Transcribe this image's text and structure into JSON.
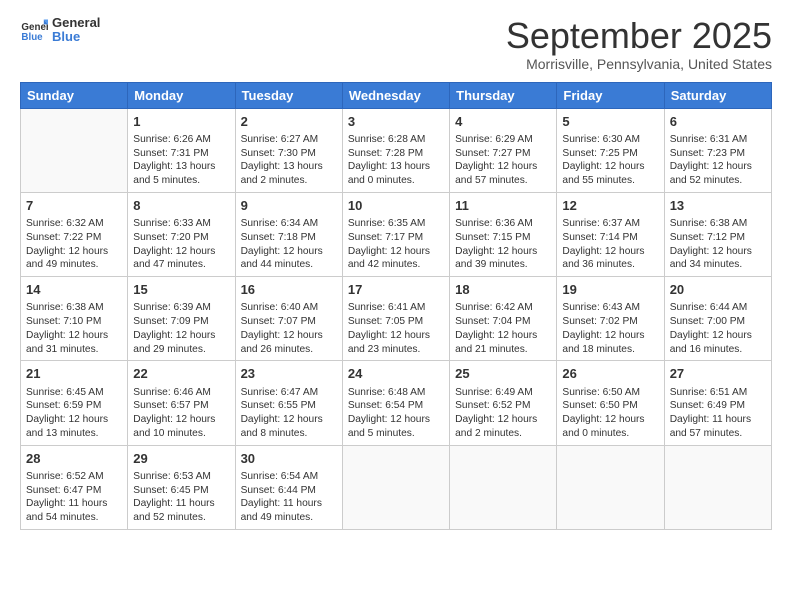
{
  "header": {
    "logo_general": "General",
    "logo_blue": "Blue",
    "month_year": "September 2025",
    "location": "Morrisville, Pennsylvania, United States"
  },
  "days_of_week": [
    "Sunday",
    "Monday",
    "Tuesday",
    "Wednesday",
    "Thursday",
    "Friday",
    "Saturday"
  ],
  "weeks": [
    [
      {
        "day": "",
        "content": ""
      },
      {
        "day": "1",
        "content": "Sunrise: 6:26 AM\nSunset: 7:31 PM\nDaylight: 13 hours\nand 5 minutes."
      },
      {
        "day": "2",
        "content": "Sunrise: 6:27 AM\nSunset: 7:30 PM\nDaylight: 13 hours\nand 2 minutes."
      },
      {
        "day": "3",
        "content": "Sunrise: 6:28 AM\nSunset: 7:28 PM\nDaylight: 13 hours\nand 0 minutes."
      },
      {
        "day": "4",
        "content": "Sunrise: 6:29 AM\nSunset: 7:27 PM\nDaylight: 12 hours\nand 57 minutes."
      },
      {
        "day": "5",
        "content": "Sunrise: 6:30 AM\nSunset: 7:25 PM\nDaylight: 12 hours\nand 55 minutes."
      },
      {
        "day": "6",
        "content": "Sunrise: 6:31 AM\nSunset: 7:23 PM\nDaylight: 12 hours\nand 52 minutes."
      }
    ],
    [
      {
        "day": "7",
        "content": "Sunrise: 6:32 AM\nSunset: 7:22 PM\nDaylight: 12 hours\nand 49 minutes."
      },
      {
        "day": "8",
        "content": "Sunrise: 6:33 AM\nSunset: 7:20 PM\nDaylight: 12 hours\nand 47 minutes."
      },
      {
        "day": "9",
        "content": "Sunrise: 6:34 AM\nSunset: 7:18 PM\nDaylight: 12 hours\nand 44 minutes."
      },
      {
        "day": "10",
        "content": "Sunrise: 6:35 AM\nSunset: 7:17 PM\nDaylight: 12 hours\nand 42 minutes."
      },
      {
        "day": "11",
        "content": "Sunrise: 6:36 AM\nSunset: 7:15 PM\nDaylight: 12 hours\nand 39 minutes."
      },
      {
        "day": "12",
        "content": "Sunrise: 6:37 AM\nSunset: 7:14 PM\nDaylight: 12 hours\nand 36 minutes."
      },
      {
        "day": "13",
        "content": "Sunrise: 6:38 AM\nSunset: 7:12 PM\nDaylight: 12 hours\nand 34 minutes."
      }
    ],
    [
      {
        "day": "14",
        "content": "Sunrise: 6:38 AM\nSunset: 7:10 PM\nDaylight: 12 hours\nand 31 minutes."
      },
      {
        "day": "15",
        "content": "Sunrise: 6:39 AM\nSunset: 7:09 PM\nDaylight: 12 hours\nand 29 minutes."
      },
      {
        "day": "16",
        "content": "Sunrise: 6:40 AM\nSunset: 7:07 PM\nDaylight: 12 hours\nand 26 minutes."
      },
      {
        "day": "17",
        "content": "Sunrise: 6:41 AM\nSunset: 7:05 PM\nDaylight: 12 hours\nand 23 minutes."
      },
      {
        "day": "18",
        "content": "Sunrise: 6:42 AM\nSunset: 7:04 PM\nDaylight: 12 hours\nand 21 minutes."
      },
      {
        "day": "19",
        "content": "Sunrise: 6:43 AM\nSunset: 7:02 PM\nDaylight: 12 hours\nand 18 minutes."
      },
      {
        "day": "20",
        "content": "Sunrise: 6:44 AM\nSunset: 7:00 PM\nDaylight: 12 hours\nand 16 minutes."
      }
    ],
    [
      {
        "day": "21",
        "content": "Sunrise: 6:45 AM\nSunset: 6:59 PM\nDaylight: 12 hours\nand 13 minutes."
      },
      {
        "day": "22",
        "content": "Sunrise: 6:46 AM\nSunset: 6:57 PM\nDaylight: 12 hours\nand 10 minutes."
      },
      {
        "day": "23",
        "content": "Sunrise: 6:47 AM\nSunset: 6:55 PM\nDaylight: 12 hours\nand 8 minutes."
      },
      {
        "day": "24",
        "content": "Sunrise: 6:48 AM\nSunset: 6:54 PM\nDaylight: 12 hours\nand 5 minutes."
      },
      {
        "day": "25",
        "content": "Sunrise: 6:49 AM\nSunset: 6:52 PM\nDaylight: 12 hours\nand 2 minutes."
      },
      {
        "day": "26",
        "content": "Sunrise: 6:50 AM\nSunset: 6:50 PM\nDaylight: 12 hours\nand 0 minutes."
      },
      {
        "day": "27",
        "content": "Sunrise: 6:51 AM\nSunset: 6:49 PM\nDaylight: 11 hours\nand 57 minutes."
      }
    ],
    [
      {
        "day": "28",
        "content": "Sunrise: 6:52 AM\nSunset: 6:47 PM\nDaylight: 11 hours\nand 54 minutes."
      },
      {
        "day": "29",
        "content": "Sunrise: 6:53 AM\nSunset: 6:45 PM\nDaylight: 11 hours\nand 52 minutes."
      },
      {
        "day": "30",
        "content": "Sunrise: 6:54 AM\nSunset: 6:44 PM\nDaylight: 11 hours\nand 49 minutes."
      },
      {
        "day": "",
        "content": ""
      },
      {
        "day": "",
        "content": ""
      },
      {
        "day": "",
        "content": ""
      },
      {
        "day": "",
        "content": ""
      }
    ]
  ]
}
